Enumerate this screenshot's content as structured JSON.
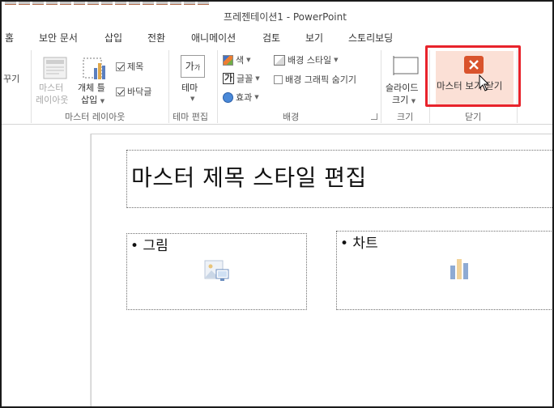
{
  "window": {
    "title": "프레젠테이션1 - PowerPoint"
  },
  "tabs": [
    {
      "label": "홈"
    },
    {
      "label": "보안 문서"
    },
    {
      "label": "삽입"
    },
    {
      "label": "전환"
    },
    {
      "label": "애니메이션"
    },
    {
      "label": "검토"
    },
    {
      "label": "보기"
    },
    {
      "label": "스토리보딩"
    }
  ],
  "ribbon": {
    "cut_label": "꾸기",
    "master_layout": {
      "master_layout_label_1": "마스터",
      "master_layout_label_2": "레이아웃",
      "placeholder_label_1": "개체 틀",
      "placeholder_label_2": "삽입",
      "title_checkbox": "제목",
      "title_checked": true,
      "footer_checkbox": "바닥글",
      "footer_checked": true,
      "group_label": "마스터 레이아웃"
    },
    "edit_theme": {
      "theme_label": "테마",
      "group_label": "테마 편집"
    },
    "background": {
      "colors_label": "색",
      "fonts_label": "글꼴",
      "effects_label": "효과",
      "bg_styles_label": "배경 스타일",
      "hide_bg_graphics_label": "배경 그래픽 숨기기",
      "hide_bg_graphics_checked": false,
      "group_label": "배경"
    },
    "size": {
      "slide_size_label_1": "슬라이드",
      "slide_size_label_2": "크기",
      "group_label": "크기"
    },
    "close": {
      "close_master_label": "마스터 보기 닫기",
      "group_label": "닫기",
      "highlight_color": "#e8232b",
      "close_icon_color": "#d9532c"
    }
  },
  "slide": {
    "title_placeholder": "마스터 제목 스타일 편집",
    "left_content": "• 그림",
    "right_content": "• 차트"
  }
}
